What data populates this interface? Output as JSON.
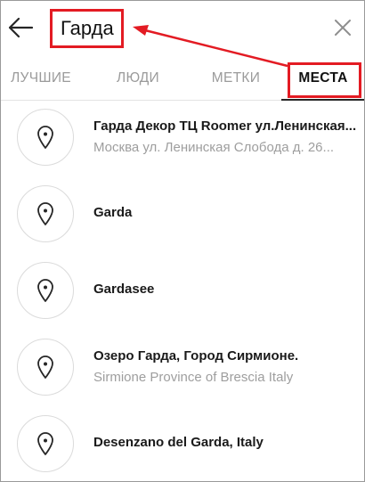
{
  "search": {
    "value": "Гарда",
    "back_icon": "arrow-left-icon",
    "clear_icon": "close-icon"
  },
  "tabs": [
    {
      "label": "ЛУЧШИЕ",
      "active": false
    },
    {
      "label": "ЛЮДИ",
      "active": false
    },
    {
      "label": "МЕТКИ",
      "active": false
    },
    {
      "label": "МЕСТА",
      "active": true
    }
  ],
  "results": [
    {
      "title": "Гарда Декор ТЦ Roomer ул.Ленинская...",
      "subtitle": "Москва ул. Ленинская Слобода д. 26..."
    },
    {
      "title": "Garda",
      "subtitle": ""
    },
    {
      "title": "Gardasee",
      "subtitle": ""
    },
    {
      "title": "Озеро Гарда, Город Сирмионе.",
      "subtitle": "Sirmione Province of Brescia Italy"
    },
    {
      "title": "Desenzano del Garda, Italy",
      "subtitle": ""
    }
  ],
  "colors": {
    "highlight": "#e31b23",
    "text": "#1a1a1a",
    "muted": "#9e9e9e"
  }
}
